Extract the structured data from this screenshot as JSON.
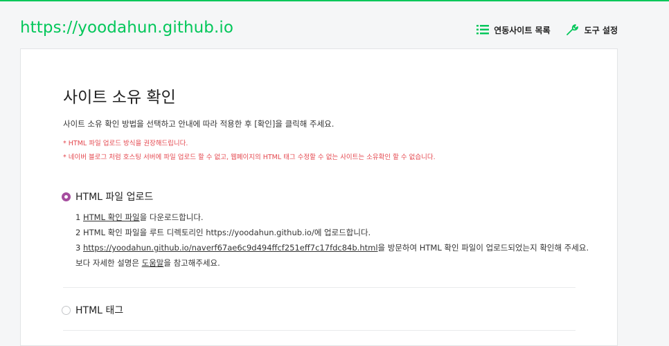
{
  "header": {
    "site_url": "https://yoodahun.github.io",
    "nav": {
      "linked_sites": "연동사이트 목록",
      "tool_settings": "도구 설정"
    }
  },
  "main": {
    "title": "사이트 소유 확인",
    "description": "사이트 소유 확인 방법을 선택하고 안내에 따라 적용한 후 [확인]을 클릭해 주세요.",
    "notes": [
      "HTML 파일 업로드 방식을 권장해드립니다.",
      "네이버 블로그 처럼 호스팅 서버에 파일 업로드 할 수 없고, 웹페이지의 HTML 태그 수정할 수 없는 사이트는 소유확인 할 수 없습니다."
    ],
    "options": [
      {
        "label": "HTML 파일 업로드",
        "selected": true
      },
      {
        "label": "HTML 태그",
        "selected": false
      }
    ],
    "steps": {
      "s1": {
        "num": "1",
        "link": "HTML 확인 파일",
        "rest": "을 다운로드합니다."
      },
      "s2": {
        "text": "2 HTML 확인 파일을 루트 디렉토리인 https://yoodahun.github.io/에 업로드합니다."
      },
      "s3": {
        "num": "3",
        "link": "https://yoodahun.github.io/naverf67ae6c9d494ffcf251eff7c17fdc84b.html",
        "rest": "을 방문하여 HTML 확인 파일이 업로드되었는지 확인해 주세요."
      },
      "s4": {
        "pre": "보다 자세한 설명은 ",
        "link": "도움말",
        "rest": "을 참고해주세요."
      }
    }
  },
  "colors": {
    "brand_green": "#03c75a",
    "radio_selected": "#a64d9f",
    "note_red": "#e4484f"
  },
  "icons": {
    "linked_sites": "list-icon",
    "tool_settings": "wrench-icon"
  }
}
